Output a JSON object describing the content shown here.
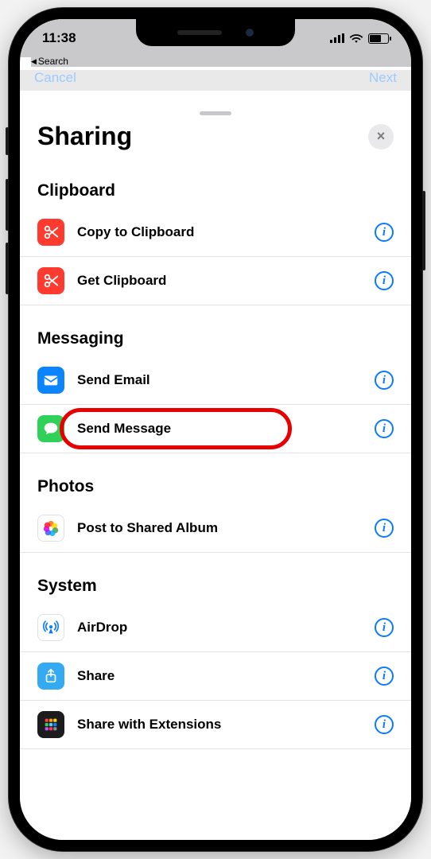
{
  "status": {
    "time": "11:38",
    "back_label": "Search"
  },
  "nav_behind": {
    "left": "Cancel",
    "right": "Next"
  },
  "sheet": {
    "title": "Sharing",
    "close_label": "×",
    "info_glyph": "i"
  },
  "sections": [
    {
      "title": "Clipboard",
      "items": [
        {
          "id": "copy-clipboard",
          "label": "Copy to Clipboard",
          "icon": "scissors",
          "bg": "ic-red"
        },
        {
          "id": "get-clipboard",
          "label": "Get Clipboard",
          "icon": "scissors",
          "bg": "ic-red"
        }
      ]
    },
    {
      "title": "Messaging",
      "items": [
        {
          "id": "send-email",
          "label": "Send Email",
          "icon": "mail",
          "bg": "ic-blue"
        },
        {
          "id": "send-message",
          "label": "Send Message",
          "icon": "message",
          "bg": "ic-green",
          "highlighted": true
        }
      ]
    },
    {
      "title": "Photos",
      "items": [
        {
          "id": "post-album",
          "label": "Post to Shared Album",
          "icon": "photos",
          "bg": "ic-white"
        }
      ]
    },
    {
      "title": "System",
      "items": [
        {
          "id": "airdrop",
          "label": "AirDrop",
          "icon": "airdrop",
          "bg": "ic-white"
        },
        {
          "id": "share",
          "label": "Share",
          "icon": "share",
          "bg": "ic-lblue"
        },
        {
          "id": "share-ext",
          "label": "Share with Extensions",
          "icon": "grid",
          "bg": "ic-dark"
        }
      ]
    }
  ]
}
